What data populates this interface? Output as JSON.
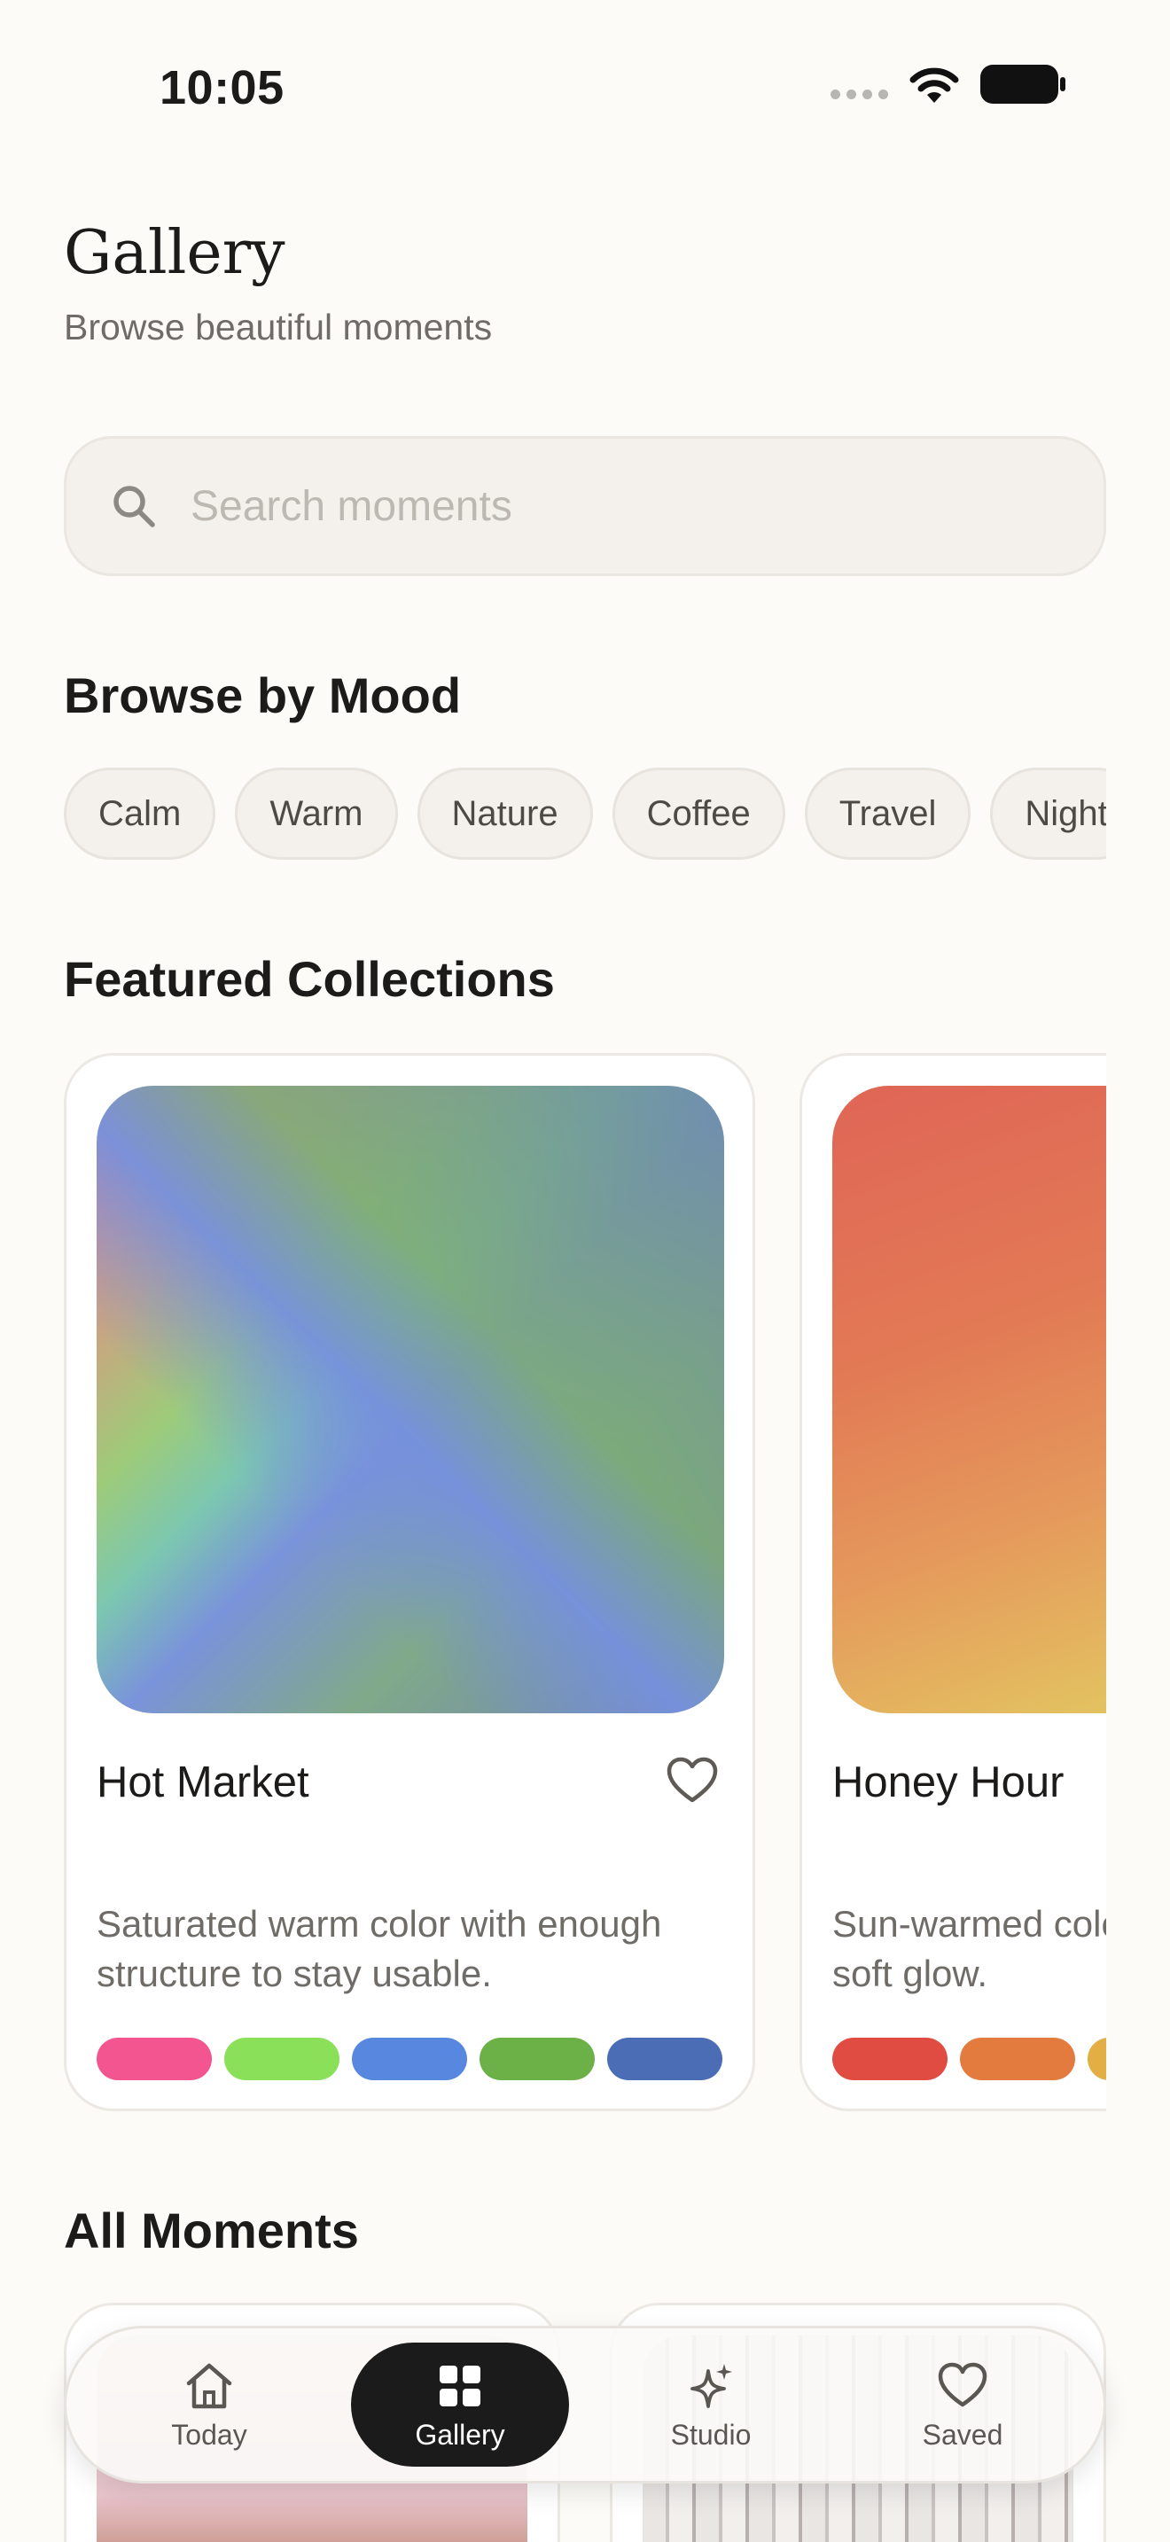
{
  "status_bar": {
    "time": "10:05"
  },
  "header": {
    "title": "Gallery",
    "subtitle": "Browse beautiful moments"
  },
  "search": {
    "placeholder": "Search moments"
  },
  "sections": {
    "mood": "Browse by Mood",
    "featured": "Featured Collections",
    "all": "All Moments"
  },
  "moods": [
    "Calm",
    "Warm",
    "Nature",
    "Coffee",
    "Travel",
    "Night"
  ],
  "collections": [
    {
      "title": "Hot Market",
      "description": "Saturated warm color with enough structure to stay usable.",
      "swatches": [
        "#F2558F",
        "#8BE05A",
        "#5787DE",
        "#6CB048",
        "#4A6DB5"
      ]
    },
    {
      "title": "Honey Hour",
      "description": "Sun-warmed color with depth and a soft glow.",
      "swatches": [
        "#E04B42",
        "#E37A3E",
        "#E3AE44"
      ]
    }
  ],
  "tabs": [
    {
      "label": "Today",
      "icon": "house-icon"
    },
    {
      "label": "Gallery",
      "icon": "grid-icon"
    },
    {
      "label": "Studio",
      "icon": "sparkle-icon"
    },
    {
      "label": "Saved",
      "icon": "heart-icon"
    }
  ]
}
